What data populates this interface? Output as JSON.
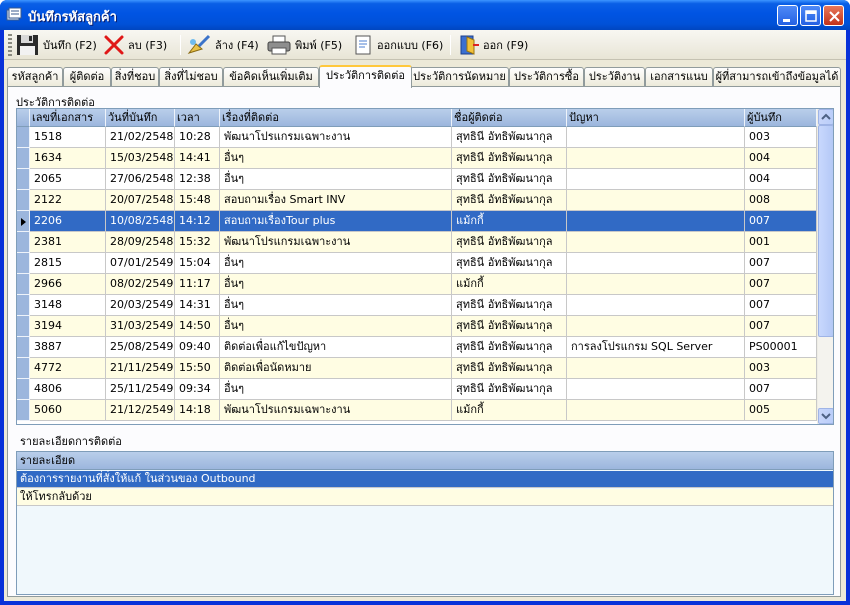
{
  "window": {
    "title": "บันทึกรหัสลูกค้า"
  },
  "toolbar": {
    "save": "บันทึก (F2)",
    "delete": "ลบ (F3)",
    "clear": "ล้าง (F4)",
    "print": "พิมพ์ (F5)",
    "design": "ออกแบบ (F6)",
    "exit": "ออก (F9)"
  },
  "tabs": [
    "รหัสลูกค้า",
    "ผู้ติดต่อ",
    "สิ่งที่ชอบ",
    "สิ่งที่ไม่ชอบ",
    "ข้อคิดเห็นเพิ่มเติม",
    "ประวัติการติดต่อ",
    "ประวัติการนัดหมาย",
    "ประวัติการซื้อ",
    "ประวัติงาน",
    "เอกสารแนบ",
    "ผู้ที่สามารถเข้าถึงข้อมูลได้"
  ],
  "active_tab": "ประวัติการติดต่อ",
  "contact_history": {
    "section_label": "ประวัติการติดต่อ",
    "columns": [
      "เลขที่เอกสาร",
      "วันที่บันทึก",
      "เวลา",
      "เรื่องที่ติดต่อ",
      "ชื่อผู้ติดต่อ",
      "ปัญหา",
      "ผู้บันทึก"
    ],
    "selected_index": 4,
    "rows": [
      [
        "1518",
        "21/02/2548",
        "10:28",
        "พัฒนาโปรแกรมเฉพาะงาน",
        "สุทธินี  อัทธิพัฒนากุล",
        "",
        "003"
      ],
      [
        "1634",
        "15/03/2548",
        "14:41",
        "อื่นๆ",
        "สุทธินี  อัทธิพัฒนากุล",
        "",
        "004"
      ],
      [
        "2065",
        "27/06/2548",
        "12:38",
        "อื่นๆ",
        "สุทธินี  อัทธิพัฒนากุล",
        "",
        "004"
      ],
      [
        "2122",
        "20/07/2548",
        "15:48",
        "สอบถามเรื่อง Smart INV",
        "สุทธินี  อัทธิพัฒนากุล",
        "",
        "008"
      ],
      [
        "2206",
        "10/08/2548",
        "14:12",
        "สอบถามเรื่องTour plus",
        "แม้กกี้",
        "",
        "007"
      ],
      [
        "2381",
        "28/09/2548",
        "15:32",
        "พัฒนาโปรแกรมเฉพาะงาน",
        "สุทธินี  อัทธิพัฒนากุล",
        "",
        "001"
      ],
      [
        "2815",
        "07/01/2549",
        "15:04",
        "อื่นๆ",
        "สุทธินี  อัทธิพัฒนากุล",
        "",
        "007"
      ],
      [
        "2966",
        "08/02/2549",
        "11:17",
        "อื่นๆ",
        "แม้กกี้",
        "",
        "007"
      ],
      [
        "3148",
        "20/03/2549",
        "14:31",
        "อื่นๆ",
        "สุทธินี  อัทธิพัฒนากุล",
        "",
        "007"
      ],
      [
        "3194",
        "31/03/2549",
        "14:50",
        "อื่นๆ",
        "สุทธินี  อัทธิพัฒนากุล",
        "",
        "007"
      ],
      [
        "3887",
        "25/08/2549",
        "09:40",
        "ติดต่อเพื่อแก้ไขปัญหา",
        "สุทธินี  อัทธิพัฒนากุล",
        "การลงโปรแกรม SQL Server",
        "PS00001"
      ],
      [
        "4772",
        "21/11/2549",
        "15:50",
        "ติดต่อเพื่อนัดหมาย",
        "สุทธินี  อัทธิพัฒนากุล",
        "",
        "003"
      ],
      [
        "4806",
        "25/11/2549",
        "09:34",
        "อื่นๆ",
        "สุทธินี  อัทธิพัฒนากุล",
        "",
        "007"
      ],
      [
        "5060",
        "21/12/2549",
        "14:18",
        "พัฒนาโปรแกรมเฉพาะงาน",
        "แม้กกี้",
        "",
        "005"
      ]
    ]
  },
  "details": {
    "section_label": "รายละเอียดการติดต่อ",
    "column": "รายละเอียด",
    "rows": [
      "ต้องการรายงานที่สั่งให้แก้ ในส่วนของ Outbound",
      "ให้โทรกลับด้วย"
    ]
  }
}
